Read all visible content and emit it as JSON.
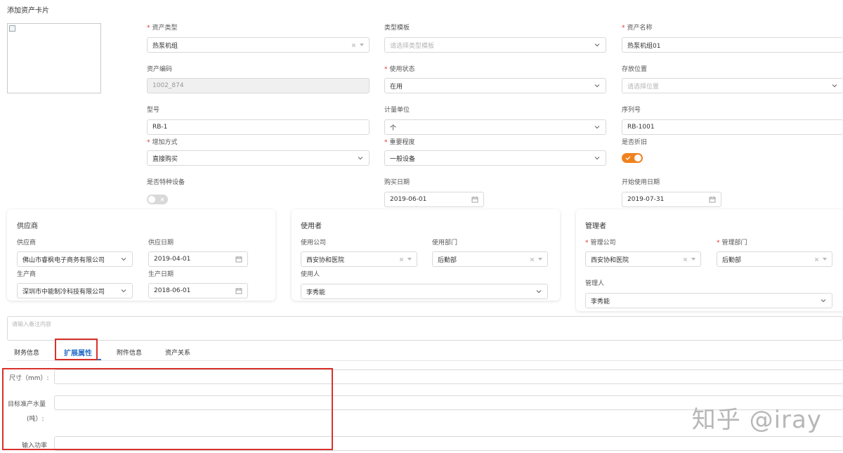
{
  "page": {
    "title": "添加资产卡片"
  },
  "form": {
    "asset_type": {
      "label": "资产类型",
      "value": "热泵机组"
    },
    "type_template": {
      "label": "类型模板",
      "placeholder": "请选择类型模板"
    },
    "asset_name": {
      "label": "资产名称",
      "value": "热泵机组01"
    },
    "asset_code": {
      "label": "资产编码",
      "value": "1002_874"
    },
    "usage_status": {
      "label": "使用状态",
      "value": "在用"
    },
    "location": {
      "label": "存放位置",
      "placeholder": "请选择位置"
    },
    "model": {
      "label": "型号",
      "value": "RB-1"
    },
    "unit": {
      "label": "计量单位",
      "value": "个"
    },
    "serial": {
      "label": "序列号",
      "value": "RB-1001"
    },
    "add_method": {
      "label": "增加方式",
      "value": "直接购买"
    },
    "importance": {
      "label": "重要程度",
      "value": "一般设备"
    },
    "depreciation": {
      "label": "是否折旧",
      "on": true
    },
    "special_equipment": {
      "label": "是否特种设备",
      "on": false
    },
    "purchase_date": {
      "label": "购买日期",
      "value": "2019-06-01"
    },
    "start_date": {
      "label": "开始使用日期",
      "value": "2019-07-31"
    }
  },
  "supplier_card": {
    "title": "供应商",
    "supplier": {
      "label": "供应商",
      "value": "佛山市睿枫电子商务有限公司"
    },
    "supply_date": {
      "label": "供应日期",
      "value": "2019-04-01"
    },
    "manufacturer": {
      "label": "生产商",
      "value": "深圳市中能制冷科技有限公司"
    },
    "production_date": {
      "label": "生产日期",
      "value": "2018-06-01"
    }
  },
  "user_card": {
    "title": "使用者",
    "company": {
      "label": "使用公司",
      "value": "西安协和医院"
    },
    "department": {
      "label": "使用部门",
      "value": "后勤部"
    },
    "user": {
      "label": "使用人",
      "value": "李秀能"
    }
  },
  "manager_card": {
    "title": "管理者",
    "company": {
      "label": "管理公司",
      "value": "西安协和医院"
    },
    "department": {
      "label": "管理部门",
      "value": "后勤部"
    },
    "manager": {
      "label": "管理人",
      "value": "李秀能"
    }
  },
  "remark": {
    "placeholder": "请输入备注内容"
  },
  "tabs": [
    {
      "label": "财务信息"
    },
    {
      "label": "扩展属性"
    },
    {
      "label": "附件信息"
    },
    {
      "label": "资产关系"
    }
  ],
  "ext": {
    "size_label": "尺寸（mm）:",
    "water_label_1": "目标准产水量",
    "water_label_2": "(吨）:",
    "power_label": "输入功率"
  },
  "watermark": "知乎 @iray",
  "colors": {
    "accent": "#2a72c9",
    "toggle_on": "#f0821e",
    "required": "#e0382c",
    "highlight": "#d9312b"
  }
}
